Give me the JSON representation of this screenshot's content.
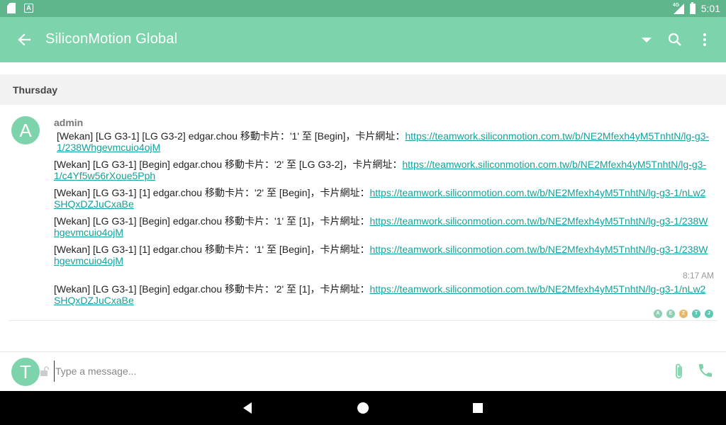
{
  "status_bar": {
    "time": "5:01",
    "network": "4G",
    "icons": [
      "sd-card-icon",
      "a-icon",
      "signal-icon",
      "battery-icon"
    ]
  },
  "toolbar": {
    "title": "SiliconMotion Global",
    "icons": [
      "back-arrow-icon",
      "dropdown-icon",
      "search-icon",
      "more-vert-icon"
    ]
  },
  "chat": {
    "day_label": "Thursday",
    "author": "admin",
    "author_initial": "A",
    "messages": [
      {
        "text": "[Wekan] [LG G3-1] [LG G3-2] edgar.chou 移動卡片：'1' 至 [Begin]，卡片網址：",
        "link": "https://teamwork.siliconmotion.com.tw/b/NE2Mfexh4yM5TnhtN/lg-g3-1/238Whgevmcuio4ojM"
      },
      {
        "text": "[Wekan] [LG G3-1] [Begin] edgar.chou 移動卡片：'2' 至 [LG G3-2]，卡片網址：",
        "link": "https://teamwork.siliconmotion.com.tw/b/NE2Mfexh4yM5TnhtN/lg-g3-1/c4Yf5w56rXoue5Pph"
      },
      {
        "text": "[Wekan] [LG G3-1] [1] edgar.chou 移動卡片：'2' 至 [Begin]，卡片網址：",
        "link": "https://teamwork.siliconmotion.com.tw/b/NE2Mfexh4yM5TnhtN/lg-g3-1/nLw2SHQxDZJuCxaBe"
      },
      {
        "text": "[Wekan] [LG G3-1] [Begin] edgar.chou 移動卡片：'1' 至 [1]，卡片網址：",
        "link": "https://teamwork.siliconmotion.com.tw/b/NE2Mfexh4yM5TnhtN/lg-g3-1/238Whgevmcuio4ojM"
      },
      {
        "text": "[Wekan] [LG G3-1] [1] edgar.chou 移動卡片：'1' 至 [Begin]，卡片網址：",
        "link": "https://teamwork.siliconmotion.com.tw/b/NE2Mfexh4yM5TnhtN/lg-g3-1/238Whgevmcuio4ojM"
      },
      {
        "text": "[Wekan] [LG G3-1] [Begin] edgar.chou 移動卡片：'2' 至 [1]，卡片網址：",
        "link": "https://teamwork.siliconmotion.com.tw/b/NE2Mfexh4yM5TnhtN/lg-g3-1/nLw2SHQxDZJuCxaBe"
      }
    ],
    "time_label": "8:17 AM",
    "read_receipts": [
      {
        "initial": "A",
        "color": "#8fd1b4"
      },
      {
        "initial": "E",
        "color": "#8fd1b4"
      },
      {
        "initial": "Z",
        "color": "#e8b86a"
      },
      {
        "initial": "T",
        "color": "#5cc9b5"
      },
      {
        "initial": "J",
        "color": "#5cc9b5"
      }
    ]
  },
  "composer": {
    "avatar_initial": "T",
    "placeholder": "Type a message...",
    "icons": [
      "lock-icon",
      "attach-icon",
      "phone-icon"
    ]
  },
  "nav_bar": {
    "icons": [
      "back-triangle-icon",
      "home-circle-icon",
      "recents-square-icon"
    ]
  },
  "colors": {
    "accent": "#7dd3ab",
    "status_bar": "#5fb58c",
    "link": "#16a0a0"
  }
}
